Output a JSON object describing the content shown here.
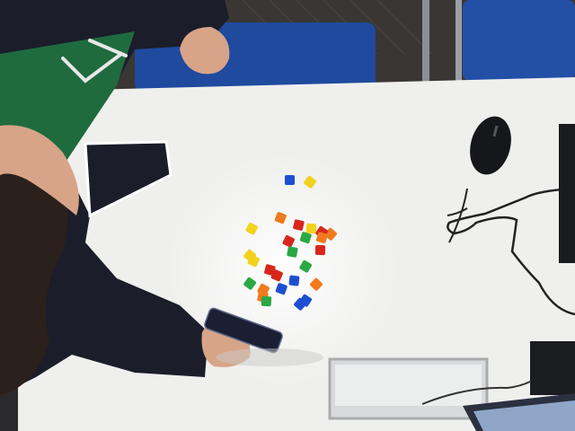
{
  "scene": {
    "colors": {
      "table": "#efefee",
      "floor": "#3a3634",
      "chair": "#1f4a9e",
      "sleeve": "#1b1d2a",
      "hoodie_green": "#1f6b3e",
      "skin": "#d7a488",
      "hair": "#2a201c"
    },
    "blocks": [
      {
        "color": "#1f4fd1"
      },
      {
        "color": "#f2d21c"
      },
      {
        "color": "#f2d21c"
      },
      {
        "color": "#f07a1c"
      },
      {
        "color": "#d9261c"
      },
      {
        "color": "#f2d21c"
      },
      {
        "color": "#f07a1c"
      },
      {
        "color": "#d9261c"
      },
      {
        "color": "#d9261c"
      },
      {
        "color": "#2aa844"
      },
      {
        "color": "#2aa844"
      },
      {
        "color": "#d9261c"
      },
      {
        "color": "#f2d21c"
      },
      {
        "color": "#2aa844"
      },
      {
        "color": "#d9261c"
      },
      {
        "color": "#d9261c"
      },
      {
        "color": "#1f4fd1"
      },
      {
        "color": "#f07a1c"
      },
      {
        "color": "#2aa844"
      },
      {
        "color": "#f07a1c"
      },
      {
        "color": "#1f4fd1"
      },
      {
        "color": "#f07a1c"
      },
      {
        "color": "#2aa844"
      },
      {
        "color": "#1f4fd1"
      },
      {
        "color": "#1f4fd1"
      },
      {
        "color": "#f2d21c"
      },
      {
        "color": "#f07a1c"
      }
    ]
  }
}
